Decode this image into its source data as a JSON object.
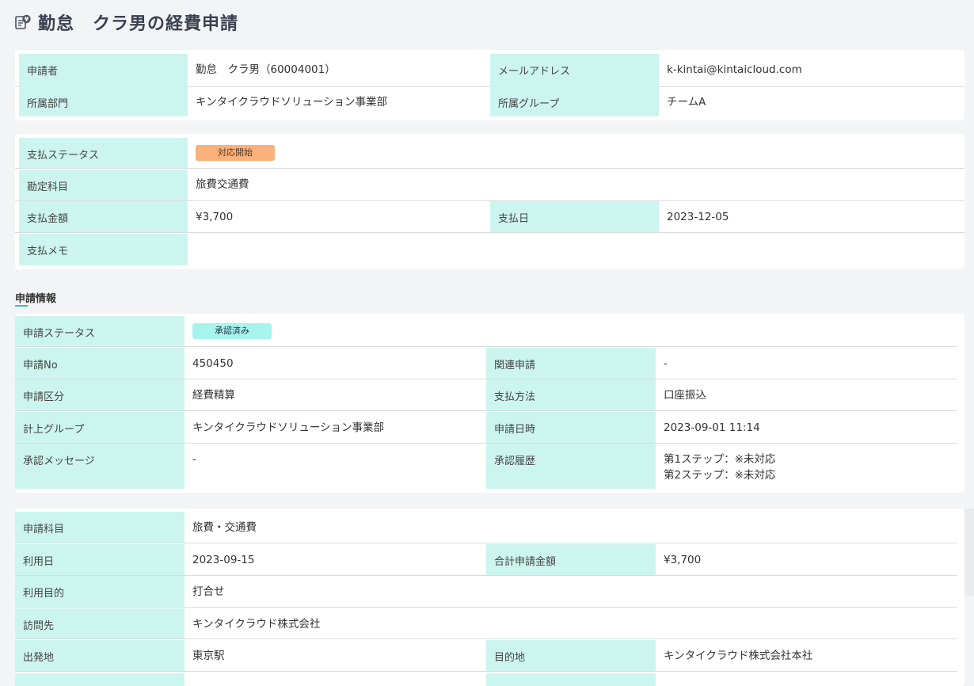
{
  "page": {
    "title": "勤怠　クラ男の経費申請",
    "title_icon": "receipt-yen-icon"
  },
  "applicant": {
    "applicant_label": "申請者",
    "applicant_value": "勤怠　クラ男（60004001）",
    "email_label": "メールアドレス",
    "email_value": "k-kintai@kintaicloud.com",
    "department_label": "所属部門",
    "department_value": "キンタイクラウドソリューション事業部",
    "group_label": "所属グループ",
    "group_value": "チームA"
  },
  "payment": {
    "status_label": "支払ステータス",
    "status_badge": "対応開始",
    "account_label": "勘定科目",
    "account_value": "旅費交通費",
    "amount_label": "支払金額",
    "amount_value": "¥3,700",
    "date_label": "支払日",
    "date_value": "2023-12-05",
    "memo_label": "支払メモ",
    "memo_value": ""
  },
  "section": {
    "heading": "申請情報"
  },
  "application": {
    "status_label": "申請ステータス",
    "status_badge": "承認済み",
    "no_label": "申請No",
    "no_value": "450450",
    "related_label": "関連申請",
    "related_value": "-",
    "category_label": "申請区分",
    "category_value": "経費精算",
    "method_label": "支払方法",
    "method_value": "口座振込",
    "group_label": "計上グループ",
    "group_value": "キンタイクラウドソリューション事業部",
    "datetime_label": "申請日時",
    "datetime_value": "2023-09-01 11:14",
    "message_label": "承認メッセージ",
    "message_value": "-",
    "history_label": "承認履歴",
    "history_step1": "第1ステップ：※未対応",
    "history_step2": "第2ステップ：※未対応"
  },
  "detail": {
    "subject_label": "申請科目",
    "subject_value": "旅費・交通費",
    "use_date_label": "利用日",
    "use_date_value": "2023-09-15",
    "total_label": "合計申請金額",
    "total_value": "¥3,700",
    "purpose_label": "利用目的",
    "purpose_value": "打合せ",
    "visit_label": "訪問先",
    "visit_value": "キンタイクラウド株式会社",
    "departure_label": "出発地",
    "departure_value": "東京駅",
    "destination_label": "目的地",
    "destination_value": "キンタイクラウド株式会社本社"
  },
  "colors": {
    "label_bg": "#cdf5ef",
    "badge_orange": "#fbb17c",
    "badge_cyan": "#a7f3ee",
    "accent": "#2cc4b7"
  }
}
